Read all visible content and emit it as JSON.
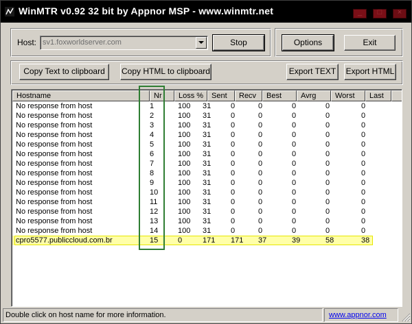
{
  "window": {
    "title": "WinMTR v0.92 32 bit by Appnor MSP - www.winmtr.net"
  },
  "host": {
    "label": "Host:",
    "value": "sv1.foxworldserver.com"
  },
  "buttons": {
    "stop": "Stop",
    "options": "Options",
    "exit": "Exit",
    "copy_text": "Copy Text to clipboard",
    "copy_html": "Copy HTML to clipboard",
    "export_text": "Export TEXT",
    "export_html": "Export HTML"
  },
  "table": {
    "columns": [
      "Hostname",
      "Nr",
      "Loss %",
      "Sent",
      "Recv",
      "Best",
      "Avrg",
      "Worst",
      "Last"
    ],
    "rows": [
      [
        "No response from host",
        "1",
        "100",
        "31",
        "0",
        "0",
        "0",
        "0",
        "0"
      ],
      [
        "No response from host",
        "2",
        "100",
        "31",
        "0",
        "0",
        "0",
        "0",
        "0"
      ],
      [
        "No response from host",
        "3",
        "100",
        "31",
        "0",
        "0",
        "0",
        "0",
        "0"
      ],
      [
        "No response from host",
        "4",
        "100",
        "31",
        "0",
        "0",
        "0",
        "0",
        "0"
      ],
      [
        "No response from host",
        "5",
        "100",
        "31",
        "0",
        "0",
        "0",
        "0",
        "0"
      ],
      [
        "No response from host",
        "6",
        "100",
        "31",
        "0",
        "0",
        "0",
        "0",
        "0"
      ],
      [
        "No response from host",
        "7",
        "100",
        "31",
        "0",
        "0",
        "0",
        "0",
        "0"
      ],
      [
        "No response from host",
        "8",
        "100",
        "31",
        "0",
        "0",
        "0",
        "0",
        "0"
      ],
      [
        "No response from host",
        "9",
        "100",
        "31",
        "0",
        "0",
        "0",
        "0",
        "0"
      ],
      [
        "No response from host",
        "10",
        "100",
        "31",
        "0",
        "0",
        "0",
        "0",
        "0"
      ],
      [
        "No response from host",
        "11",
        "100",
        "31",
        "0",
        "0",
        "0",
        "0",
        "0"
      ],
      [
        "No response from host",
        "12",
        "100",
        "31",
        "0",
        "0",
        "0",
        "0",
        "0"
      ],
      [
        "No response from host",
        "13",
        "100",
        "31",
        "0",
        "0",
        "0",
        "0",
        "0"
      ],
      [
        "No response from host",
        "14",
        "100",
        "31",
        "0",
        "0",
        "0",
        "0",
        "0"
      ],
      [
        "cpro5577.publiccloud.com.br",
        "15",
        "0",
        "171",
        "171",
        "37",
        "39",
        "58",
        "38"
      ]
    ]
  },
  "status": {
    "message": "Double click on host name for more information.",
    "link": "www.appnor.com"
  },
  "colors": {
    "highlight_fill": "#ffffa8",
    "highlight_border": "#e6e600",
    "nr_box": "#2e7d32",
    "titlebar": "#000000"
  }
}
